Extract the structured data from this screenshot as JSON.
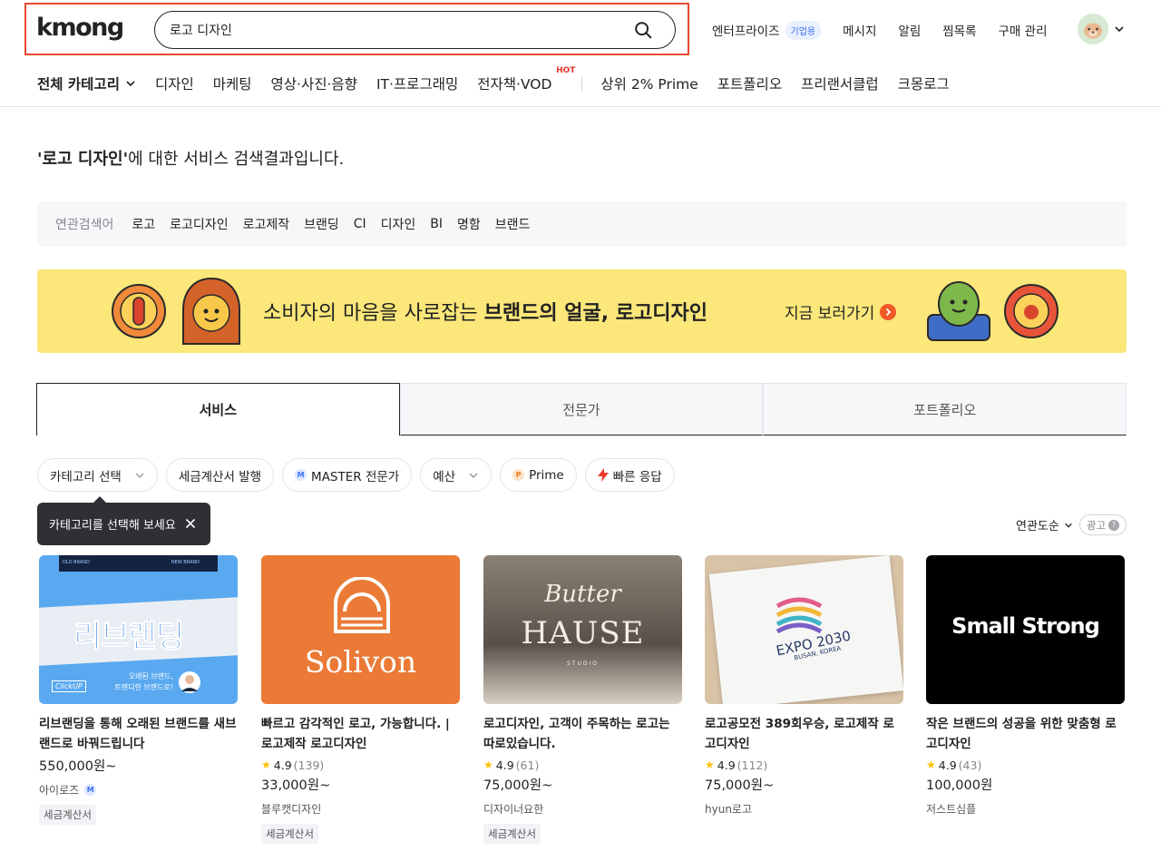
{
  "header": {
    "logo": "kmong",
    "search_value": "로고 디자인",
    "links": [
      {
        "label": "엔터프라이즈",
        "badge": "기업용"
      },
      {
        "label": "메시지"
      },
      {
        "label": "알림"
      },
      {
        "label": "찜목록"
      },
      {
        "label": "구매 관리"
      }
    ]
  },
  "nav": {
    "all_categories": "전체 카테고리",
    "items": [
      "디자인",
      "마케팅",
      "영상·사진·음향",
      "IT·프로그래밍",
      "전자책·VOD"
    ],
    "hot_label": "HOT",
    "extra": [
      "상위 2% Prime",
      "포트폴리오",
      "프리랜서클럽",
      "크몽로그"
    ]
  },
  "results": {
    "query_quoted": "'로고 디자인'",
    "suffix": "에 대한 서비스 검색결과입니다."
  },
  "related": {
    "label": "연관검색어",
    "keywords": [
      "로고",
      "로고디자인",
      "로고제작",
      "브랜딩",
      "CI",
      "디자인",
      "BI",
      "명함",
      "브랜드"
    ]
  },
  "banner": {
    "text_plain": "소비자의 마음을 사로잡는 ",
    "text_bold": "브랜드의 얼굴, 로고디자인",
    "cta": "지금 보러가기",
    "accent_color": "#fbe77a"
  },
  "tabs": [
    "서비스",
    "전문가",
    "포트폴리오"
  ],
  "filters": {
    "category": "카테고리 선택",
    "tax_invoice": "세금계산서 발행",
    "master": "MASTER 전문가",
    "budget": "예산",
    "prime": "Prime",
    "fast_response": "빠른 응답"
  },
  "tooltip": "카테고리를 선택해 보세요",
  "sort": {
    "label": "연관도순",
    "ad_label": "광고"
  },
  "cards": [
    {
      "thumb_text": "리브랜딩",
      "thumb_sub_left": "OLD BRAND",
      "thumb_sub_right": "NEW BRAND",
      "thumb_caption_1": "오래된 브랜드,",
      "thumb_caption_2": "트렌디한 브랜드로!",
      "thumb_brand": "ClickUP",
      "title": "리브랜딩을 통해 오래된 브랜드를 새브랜드로 바꿔드립니다",
      "price": "550,000원~",
      "seller": "아이로즈",
      "tag": "세금계산서"
    },
    {
      "thumb_text": "Solivon",
      "title": "빠르고 감각적인 로고, 가능합니다. | 로고제작 로고디자인",
      "rating": "4.9",
      "count": "(139)",
      "price": "33,000원~",
      "seller": "블루캣디자인",
      "tag": "세금계산서"
    },
    {
      "thumb_text_1": "Butter",
      "thumb_text_2": "HAUSE",
      "thumb_text_3": "STUDIO",
      "title": "로고디자인, 고객이 주목하는 로고는 따로있습니다.",
      "rating": "4.9",
      "count": "(61)",
      "price": "75,000원~",
      "seller": "디자이너요한",
      "tag": "세금계산서"
    },
    {
      "thumb_text_1": "EXPO 2030",
      "thumb_text_2": "BUSAN, KOREA",
      "title": "로고공모전 389회우승, 로고제작 로고디자인",
      "rating": "4.9",
      "count": "(112)",
      "price": "75,000원~",
      "seller": "hyun로고"
    },
    {
      "thumb_text": "Small Strong",
      "title": "작은 브랜드의 성공을 위한 맞춤형 로고디자인",
      "rating": "4.9",
      "count": "(43)",
      "price": "100,000원",
      "seller": "저스트심플"
    }
  ],
  "colors": {
    "accent_red": "#e64a2e",
    "hot_red": "#e8372c",
    "star": "#ffc107",
    "tooltip_bg": "#2e3035"
  }
}
